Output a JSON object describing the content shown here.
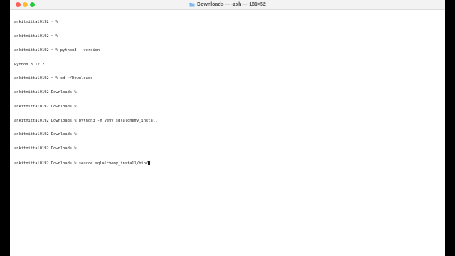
{
  "window": {
    "title": "Downloads — -zsh — 181×52",
    "folder_icon": "folder-icon"
  },
  "terminal": {
    "lines": [
      "ankitmittal0192 ~ %",
      "ankitmittal0192 ~ %",
      "ankitmittal0192 ~ % python3 --version",
      "Python 3.12.2",
      "ankitmittal0192 ~ % cd ~/Downloads",
      "ankitmittal0192 Downloads %",
      "ankitmittal0192 Downloads %",
      "ankitmittal0192 Downloads % python3 -m venv sqlalchemy_install",
      "ankitmittal0192 Downloads %",
      "ankitmittal0192 Downloads %"
    ],
    "current_prompt": "ankitmittal0192 Downloads % ",
    "current_input": "source sqlalchemy_install/bin/"
  },
  "colors": {
    "close": "#fe5f57",
    "minimize": "#febc2e",
    "maximize": "#28c840",
    "folder": "#5aa0e6"
  }
}
